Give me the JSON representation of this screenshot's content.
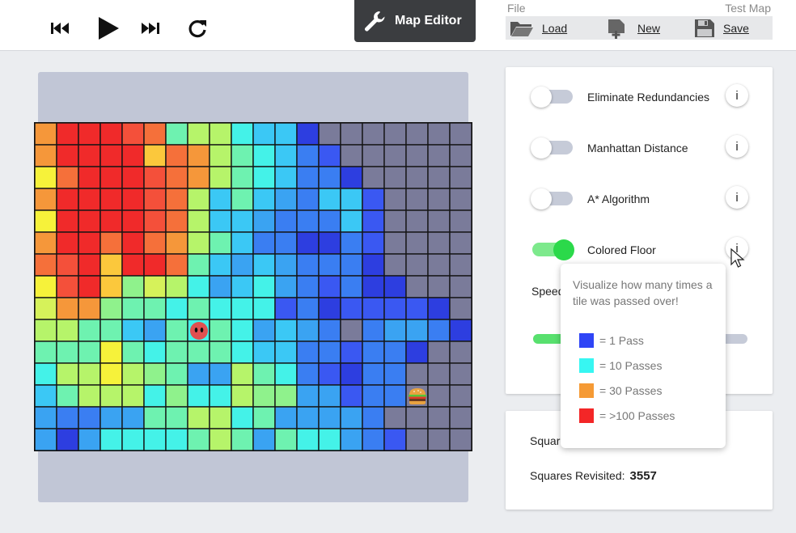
{
  "toolbar": {
    "play_controls": [
      "skip-back-icon",
      "play-icon",
      "skip-forward-icon",
      "reset-icon"
    ],
    "map_editor_label": "Map Editor"
  },
  "file": {
    "section_label": "File",
    "map_name": "Test Map",
    "load_label": "Load",
    "new_label": "New",
    "save_label": "Save"
  },
  "settings": {
    "items": [
      {
        "label": "Eliminate Redundancies",
        "enabled": false,
        "info": "i"
      },
      {
        "label": "Manhattan Distance",
        "enabled": false,
        "info": "i"
      },
      {
        "label": "A* Algorithm",
        "enabled": false,
        "info": "i"
      },
      {
        "label": "Colored Floor",
        "enabled": true,
        "info": "i"
      }
    ],
    "speed_label": "Speed",
    "speed_fraction": 0.88
  },
  "stats": {
    "squares_visited_label": "Squares Visited:",
    "squares_revisited_label": "Squares Revisited:",
    "squares_revisited_value": "3557"
  },
  "tooltip": {
    "text": "Visualize how many times a tile was passed over!",
    "legend": [
      {
        "label": "= 1 Pass",
        "color": "#2f45f6"
      },
      {
        "label": "= 10 Passes",
        "color": "#37f6f2"
      },
      {
        "label": "= 30 Passes",
        "color": "#f59a35"
      },
      {
        "label": "= >100 Passes",
        "color": "#f32627"
      }
    ]
  },
  "grid": {
    "cols": 20,
    "rows": 15,
    "palette": {
      "R": "#f02a2a",
      "r": "#f4503a",
      "o": "#f5703a",
      "O": "#f5973a",
      "y": "#fbc83c",
      "Y": "#f6f23a",
      "l": "#d6f25a",
      "L": "#b6f46a",
      "g": "#8ff28c",
      "G": "#6ef2b0",
      "c": "#44f2e8",
      "C": "#3bc8f5",
      "b": "#3aa3f2",
      "B": "#3a7ef2",
      "d": "#3a58f2",
      "D": "#2d3ee0",
      "x": "#7a7b9a"
    },
    "rows_data": [
      "ORRRroGLLcCCDxxxxxxx",
      "ORRRRyoOLGcCBdxxxxxx",
      "YoRRRroOLGcCBBDxxxxx",
      "ORRRRroLCGCbBCCdxxxx",
      "YRRRRroLCCbBBBCdxxxx",
      "ORRoRoOLGCBBDDBdxxxx",
      "orRyRRoGCbCbBBBDxxxx",
      "YrRyglLcbCcbBdBDDxxx",
      "lOOgGGcGcccdBDddddDx",
      "LLGGCbGcGcbCbBxBbbBD",
      "GGGYGcGGGcCCBBdBBDxx",
      "cLLYLgGbbLGcBdDBBxxx",
      "CGLLLcgccLggbbdBBxxx",
      "bBBbbGGLLcGbbbbBxxxx",
      "bDbccccGLGbGccbBdxxx"
    ],
    "player_tile": [
      7,
      9
    ],
    "goal_tile": [
      17,
      12
    ]
  }
}
